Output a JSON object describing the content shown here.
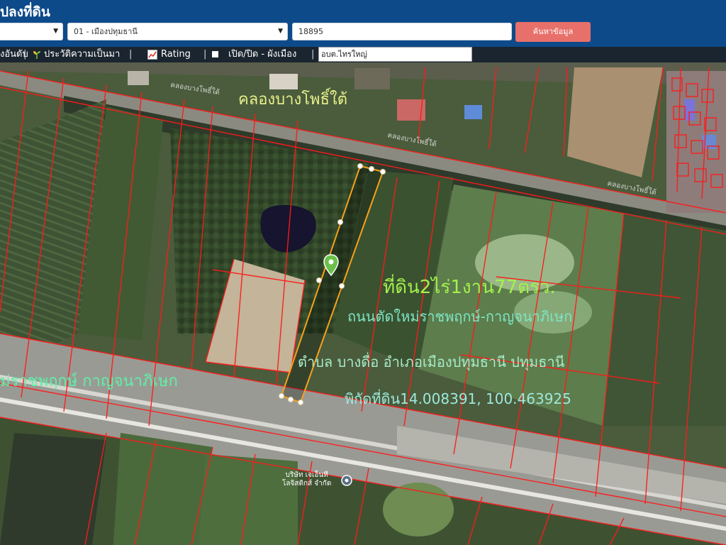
{
  "header": {
    "title": "ปลงที่ดิน"
  },
  "search": {
    "province": "",
    "district": "01 - เมืองปทุมธานี",
    "parcel_no": "18895",
    "search_label": "ค้นหาข้อมูล"
  },
  "toolbar": {
    "item_ranking": "งอันดับ",
    "item_history": "ประวัติความเป็นมา",
    "item_rating": "Rating",
    "item_cityplan": "เปิด/ปิด - ผังเมือง",
    "org_value": "อบต.ไทรใหญ่"
  },
  "map": {
    "canal_label_large": "คลองบางโพธิ์ใต้",
    "canal_label_small_1": "คลองบางโพธิ์ใต้",
    "canal_label_small_2": "คลองบางโพธิ์ใต้",
    "canal_label_small_3": "คลองบางโพธิ์ใต้",
    "road_label": "ม่ราชพฤกษ์ กาญจนาภิเษก",
    "poi_label_line1": "บริษัท เจเอ็นที",
    "poi_label_line2": "โลจิสติกส์ จำกัด",
    "annotation_area": "ที่ดิน2ไร่1งาน77ตรว.",
    "annotation_road": "ถนนตัดใหม่ราชพฤกษ์-กาญจนาภิเษก",
    "annotation_location": "ตำบล บางดื่อ อำเภอเมืองปทุมธานี ปทุมธานี",
    "annotation_coords": "พิกัดที่ดิน14.008391, 100.463925"
  },
  "colors": {
    "header_bg": "#0d4a8a",
    "toolbar_bg": "#1a2530",
    "search_button": "#e8706a",
    "parcel_lines": "#ff1a1a",
    "selected_parcel": "#f7a11a",
    "pin": "#6cc04a"
  },
  "icons": [
    "chevron-down-icon",
    "sprout-icon",
    "rating-chart-icon",
    "checkbox-icon",
    "map-pin-icon",
    "poi-marker-icon"
  ]
}
